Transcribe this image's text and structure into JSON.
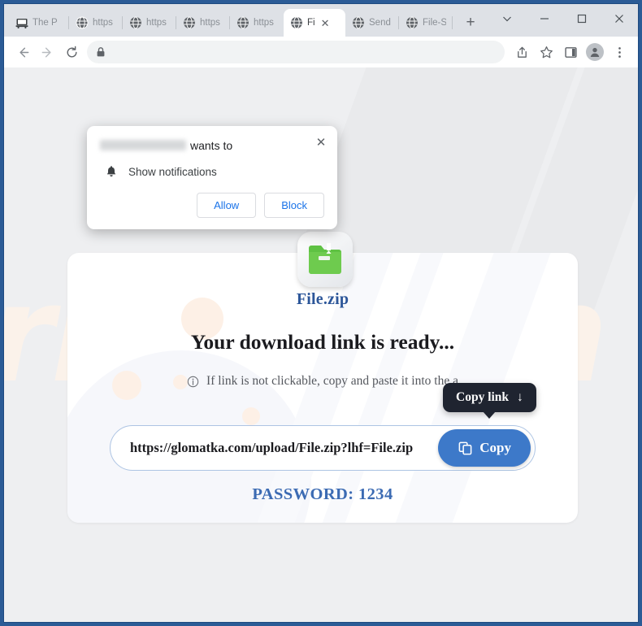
{
  "browser": {
    "tabs": [
      {
        "label": "The P",
        "icon": "device-icon",
        "active": false
      },
      {
        "label": "https",
        "icon": "globe-icon",
        "active": false
      },
      {
        "label": "https",
        "icon": "globe-icon",
        "active": false
      },
      {
        "label": "https",
        "icon": "globe-icon",
        "active": false
      },
      {
        "label": "https",
        "icon": "globe-icon",
        "active": false
      },
      {
        "label": "Fi",
        "icon": "globe-icon",
        "active": true
      },
      {
        "label": "Send",
        "icon": "globe-icon",
        "active": false
      },
      {
        "label": "File-S",
        "icon": "globe-icon",
        "active": false
      }
    ],
    "new_tab_label": "+",
    "tab_close_label": "✕",
    "window_controls": {
      "minimize_all": "∨",
      "minimize": "—",
      "maximize": "□",
      "close": "✕"
    },
    "toolbar": {
      "back": "back-arrow",
      "forward": "forward-arrow",
      "reload": "reload-icon",
      "site_info": "lock-icon",
      "address_value": "",
      "share": "share-icon",
      "bookmark": "star-icon",
      "side_panel": "side-panel-icon",
      "profile": "profile-avatar",
      "menu": "three-dot-menu"
    }
  },
  "permission_popup": {
    "host_redacted": "",
    "title_suffix": "wants to",
    "request_label": "Show notifications",
    "bell_icon": "bell-icon",
    "close_label": "✕",
    "allow_label": "Allow",
    "block_label": "Block"
  },
  "page": {
    "file_name": "File.zip",
    "headline": "Your download link is ready...",
    "hint_text": "If link is not clickable, copy and paste it into the a",
    "hint_icon": "info-icon",
    "download_url": "https://glomatka.com/upload/File.zip?lhf=File.zip",
    "copy_button_label": "Copy",
    "copy_button_icon": "copy-icon",
    "password_text": "PASSWORD: 1234",
    "zip_icon": "zip-folder-icon",
    "watermark_text": "risk.com",
    "tooltip": {
      "label": "Copy link",
      "arrow": "↓"
    }
  },
  "colors": {
    "window_frame": "#2b5b96",
    "accent_blue": "#3d79c9",
    "filename_blue": "#2c5699",
    "password_blue": "#3c6bb3",
    "tooltip_bg": "#1f2430",
    "link_blue": "#1a73e8"
  }
}
